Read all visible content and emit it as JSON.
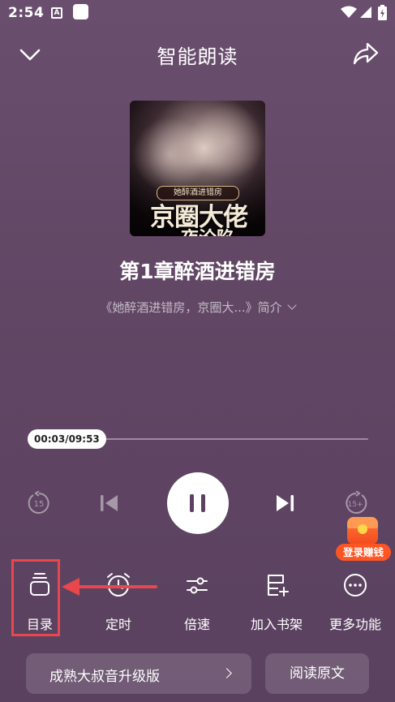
{
  "status_bar": {
    "time": "2:54",
    "app_icon_letter": "A"
  },
  "header": {
    "title": "智能朗读"
  },
  "cover": {
    "subtitle": "她醉酒进错房",
    "title": "京圈大佬",
    "title_line2": "一夜沦陷"
  },
  "chapter": {
    "title": "第1章醉酒进错房"
  },
  "book": {
    "intro": "《她醉酒进错房，京圈大...》简介"
  },
  "player": {
    "progress_text": "00:03/09:53",
    "progress_fraction": 0.005,
    "rewind_seconds": "15",
    "forward_seconds": "15+"
  },
  "reward": {
    "label": "登录赚钱"
  },
  "menu": {
    "items": [
      {
        "label": "目录",
        "icon": "catalog-icon"
      },
      {
        "label": "定时",
        "icon": "alarm-icon"
      },
      {
        "label": "倍速",
        "icon": "speed-sliders-icon"
      },
      {
        "label": "加入书架",
        "icon": "add-bookshelf-icon"
      },
      {
        "label": "更多功能",
        "icon": "more-icon"
      }
    ]
  },
  "bottom": {
    "voice_label": "成熟大叔音升级版",
    "read_label": "阅读原文"
  },
  "colors": {
    "background": "#634866",
    "accent_red": "#e8474c",
    "reward_orange": "#ff5523"
  }
}
